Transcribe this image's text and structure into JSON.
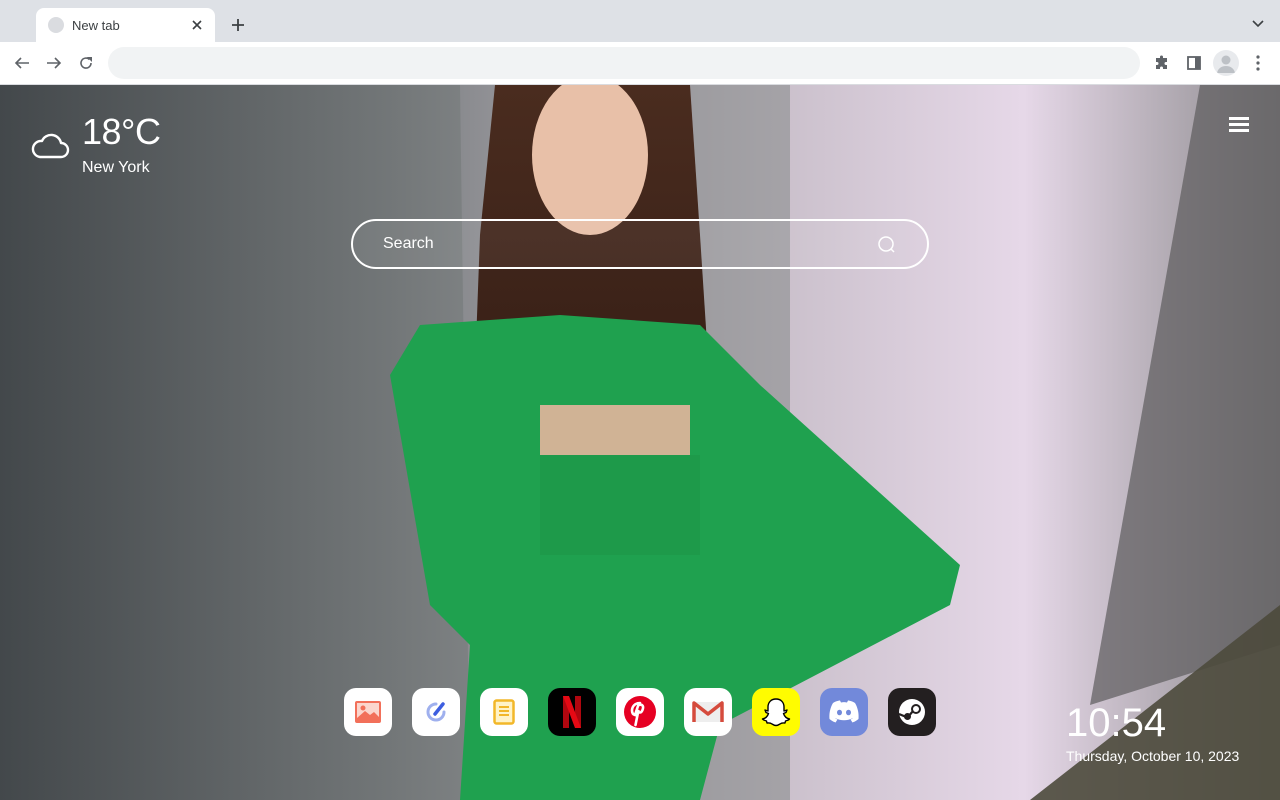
{
  "browser": {
    "tab": {
      "title": "New tab"
    },
    "omnibox": {
      "value": "",
      "placeholder": ""
    }
  },
  "weather": {
    "icon": "cloud-icon",
    "temperature": "18°C",
    "city": "New York"
  },
  "search": {
    "placeholder": "Search"
  },
  "dock": {
    "apps": [
      {
        "name": "Photos",
        "icon": "image-icon",
        "bg": "#ffffff"
      },
      {
        "name": "Tasks",
        "icon": "check-pen-icon",
        "bg": "#ffffff"
      },
      {
        "name": "Notes",
        "icon": "note-icon",
        "bg": "#ffffff"
      },
      {
        "name": "Netflix",
        "icon": "netflix-icon",
        "bg": "#000000"
      },
      {
        "name": "Pinterest",
        "icon": "pinterest-icon",
        "bg": "#ffffff"
      },
      {
        "name": "Gmail",
        "icon": "gmail-icon",
        "bg": "#ffffff"
      },
      {
        "name": "Snapchat",
        "icon": "snapchat-icon",
        "bg": "#fffc00"
      },
      {
        "name": "Discord",
        "icon": "discord-icon",
        "bg": "#7289da"
      },
      {
        "name": "Steam",
        "icon": "steam-icon",
        "bg": "#231f20"
      }
    ]
  },
  "clock": {
    "time": "10:54",
    "date": "Thursday, October 10, 2023"
  }
}
